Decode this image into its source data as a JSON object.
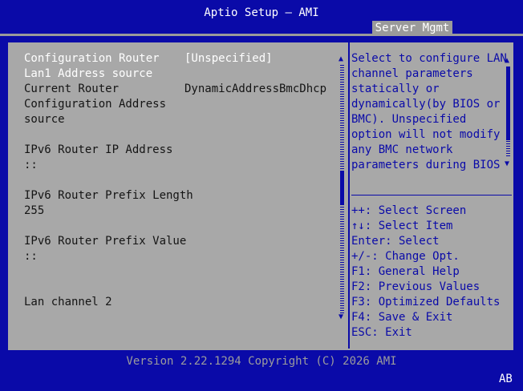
{
  "header": {
    "title": "Aptio Setup – AMI",
    "tab": "Server Mgmt"
  },
  "settings": {
    "config_router_label_1": "Configuration Router",
    "config_router_label_2": "Lan1 Address source",
    "config_router_value": "[Unspecified]",
    "current_router_label_1": "Current Router",
    "current_router_label_2": "Configuration Address",
    "current_router_label_3": "source",
    "current_router_value": "DynamicAddressBmcDhcp",
    "ipv6_ip_label": "IPv6 Router IP Address",
    "ipv6_ip_value": "::",
    "ipv6_prefix_len_label": "IPv6 Router Prefix Length",
    "ipv6_prefix_len_value": "255",
    "ipv6_prefix_val_label": "IPv6 Router Prefix Value",
    "ipv6_prefix_val_value": "::",
    "lan_channel_2": "Lan channel 2"
  },
  "help": {
    "lines": [
      "Select to configure LAN",
      "channel parameters",
      "statically or",
      "dynamically(by BIOS or",
      "BMC). Unspecified",
      "option will not modify",
      "any BMC network",
      "parameters during BIOS"
    ]
  },
  "keys": {
    "select_screen": "++: Select Screen",
    "select_item": "↑↓: Select Item",
    "enter": "Enter: Select",
    "change": "+/-: Change Opt.",
    "f1": "F1: General Help",
    "f2": "F2: Previous Values",
    "f3": "F3: Optimized Defaults",
    "f4": "F4: Save & Exit",
    "esc": "ESC: Exit"
  },
  "footer": {
    "version": "Version 2.22.1294 Copyright (C) 2026 AMI",
    "ab": "AB"
  }
}
